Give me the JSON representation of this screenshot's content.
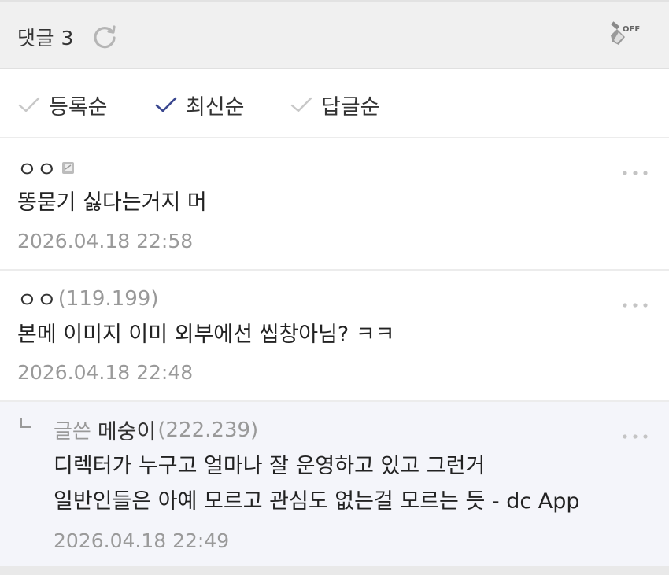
{
  "header": {
    "title": "댓글 3",
    "refresh_icon": "refresh-icon",
    "clean_icon": "broom-off-icon",
    "clean_badge": "OFF"
  },
  "sort": {
    "items": [
      {
        "label": "등록순",
        "active": false
      },
      {
        "label": "최신순",
        "active": true
      },
      {
        "label": "답글순",
        "active": false
      }
    ],
    "active_color": "#3b4890",
    "inactive_color": "#c8c8c8"
  },
  "comments": [
    {
      "nick": "ㅇㅇ",
      "ip": "",
      "body": "똥묻기 싫다는거지 머",
      "date": "2026.04.18 22:58"
    },
    {
      "nick": "ㅇㅇ",
      "ip": "(119.199)",
      "body": "본메 이미지 이미 외부에선 씹창아님? ㅋㅋ",
      "date": "2026.04.18 22:48"
    }
  ],
  "reply": {
    "writer_label": "글쓴",
    "nick": "메숭이",
    "ip": "(222.239)",
    "body_line1": "디렉터가 누구고 얼마나 잘 운영하고 있고 그런거",
    "body_line2": "일반인들은 아예 모르고 관심도 없는걸 모르는 듯 - dc App",
    "date": "2026.04.18 22:49"
  }
}
